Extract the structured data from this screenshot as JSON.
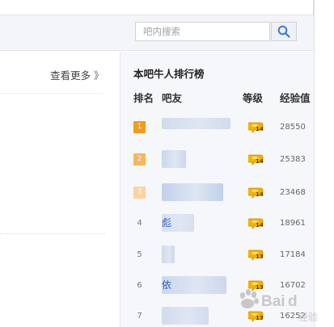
{
  "search": {
    "placeholder": "吧内搜索",
    "icon": "search-icon"
  },
  "left_section": {
    "more_link": "查看更多",
    "more_arrows": "》"
  },
  "ranking": {
    "title": "本吧牛人排行榜",
    "headers": {
      "rank": "排名",
      "user": "吧友",
      "level": "等级",
      "exp": "经验值"
    },
    "rows": [
      {
        "rank": "1",
        "name": "",
        "level": "14",
        "exp": "28550",
        "badge_color": "#f39a1f"
      },
      {
        "rank": "2",
        "name": "",
        "level": "14",
        "exp": "25383",
        "badge_color": "#f7b55c"
      },
      {
        "rank": "3",
        "name": "",
        "level": "14",
        "exp": "23468",
        "badge_color": "#fbd3a0"
      },
      {
        "rank": "4",
        "name": "彪",
        "level": "14",
        "exp": "18961",
        "badge_color": ""
      },
      {
        "rank": "5",
        "name": "",
        "level": "13",
        "exp": "17184",
        "badge_color": ""
      },
      {
        "rank": "6",
        "name": "依",
        "level": "13",
        "exp": "16702",
        "badge_color": ""
      },
      {
        "rank": "7",
        "name": "",
        "level": "13",
        "exp": "16252",
        "badge_color": ""
      }
    ]
  },
  "watermark": {
    "text": "Baidu",
    "sub": "经验"
  },
  "colors": {
    "accent": "#2d64b3",
    "level_gold": "#f2b300",
    "panel_bg": "#f6f7fa"
  }
}
